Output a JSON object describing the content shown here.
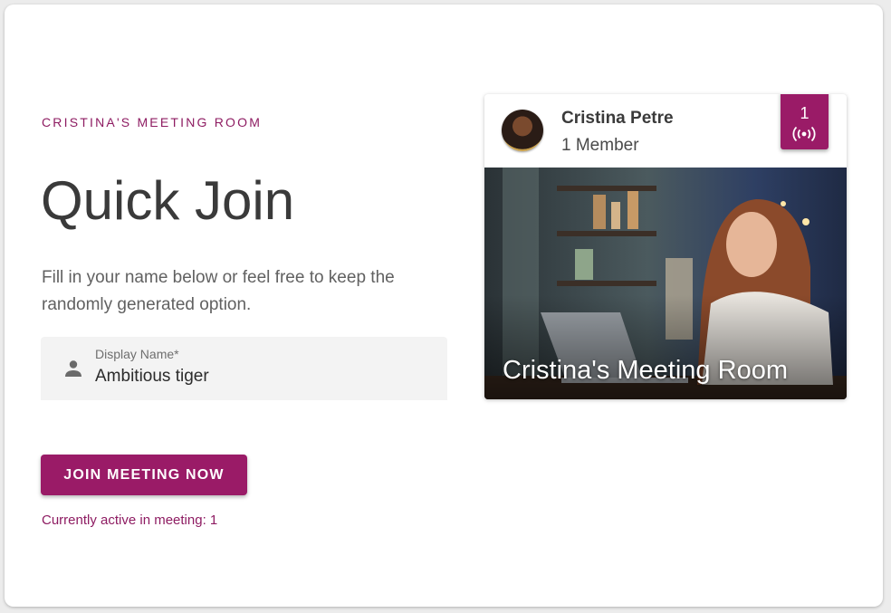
{
  "page": {
    "eyebrow": "CRISTINA'S MEETING ROOM",
    "title": "Quick Join",
    "description": "Fill in your name below or feel free to keep the randomly generated option."
  },
  "form": {
    "display_name_label": "Display Name*",
    "display_name_value": "Ambitious tiger",
    "field_icon": "person-icon"
  },
  "actions": {
    "join_label": "JOIN MEETING NOW",
    "active_note": "Currently active in meeting: 1"
  },
  "room": {
    "host_name": "Cristina Petre",
    "member_count": "1 Member",
    "live_count": "1",
    "live_icon": "broadcast-icon",
    "caption": "Cristina's Meeting Room"
  },
  "colors": {
    "accent": "#9a1b67",
    "text_dark": "#3a3a3a",
    "text_muted": "#616161",
    "field_bg": "#f3f3f3"
  }
}
